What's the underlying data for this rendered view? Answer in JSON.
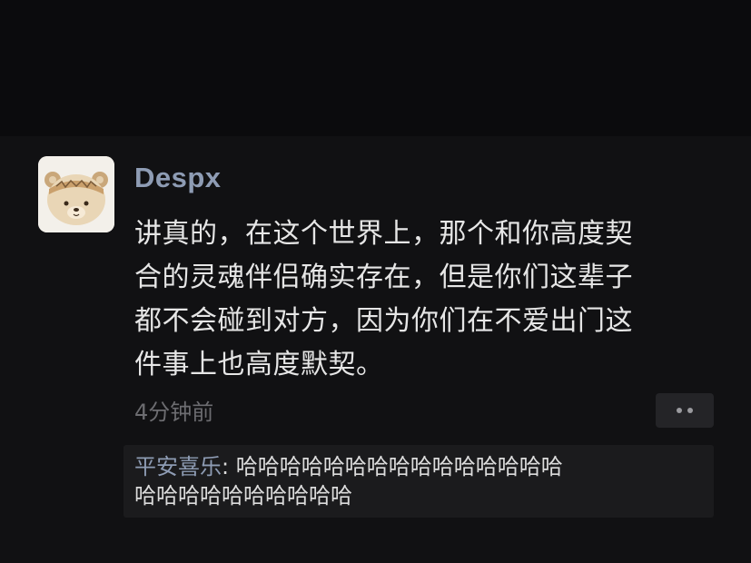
{
  "post": {
    "author": "Despx",
    "content_lines": [
      "讲真的，在这个世界上，那个和你高度契",
      "合的灵魂伴侣确实存在，但是你们这辈子",
      "都不会碰到对方，因为你们在不爱出门这",
      "件事上也高度默契。"
    ],
    "timestamp": "4分钟前",
    "more_icon": "more-dots-icon"
  },
  "comments": [
    {
      "author": "平安喜乐",
      "separator": ": ",
      "text_lines": [
        "哈哈哈哈哈哈哈哈哈哈哈哈哈哈哈",
        "哈哈哈哈哈哈哈哈哈哈"
      ]
    }
  ],
  "colors": {
    "background": "#0c0c0e",
    "card": "#111113",
    "author_name": "#8e9cb4",
    "body_text": "#e6e6e6",
    "muted": "#6c6c70",
    "comment_bg": "#1b1b1d"
  }
}
